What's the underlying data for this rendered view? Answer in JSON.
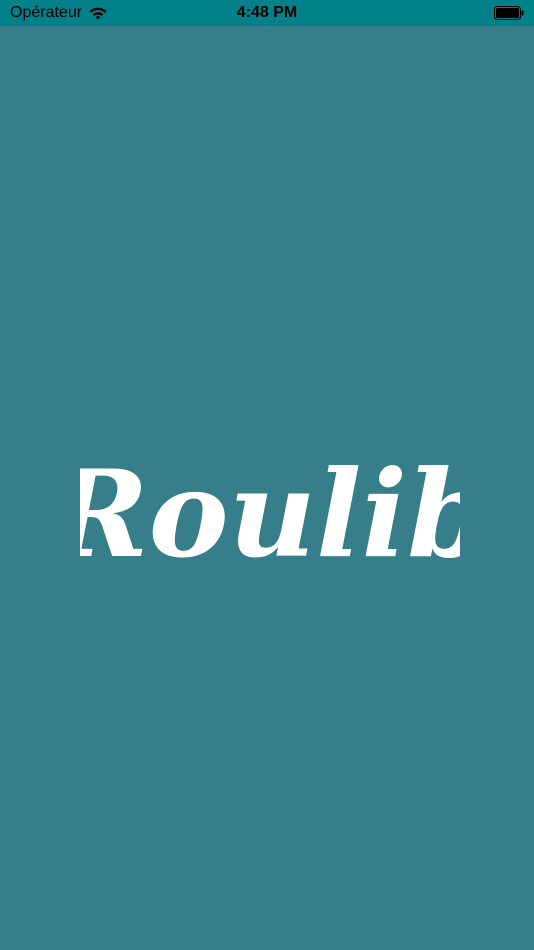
{
  "status_bar": {
    "carrier": "Opérateur",
    "time": "4:48 PM",
    "wifi_icon": "wifi-icon",
    "battery_icon": "battery-icon"
  },
  "splash": {
    "logo_text": "Roulib",
    "background_color": "#367F8A",
    "status_bar_color": "#03818B"
  }
}
